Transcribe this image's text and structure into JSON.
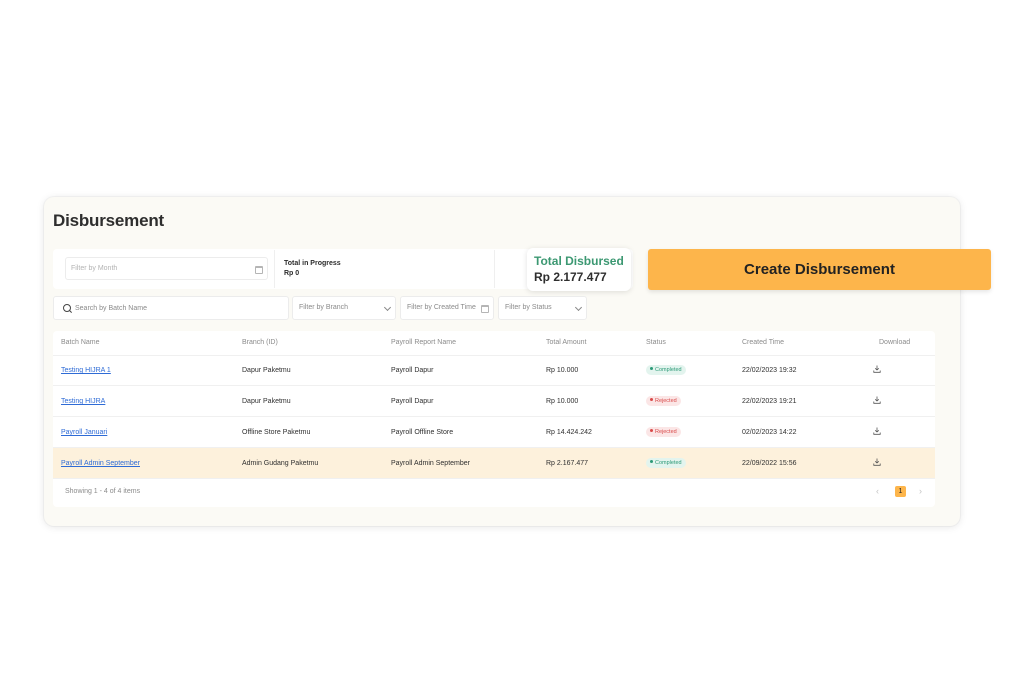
{
  "page": {
    "title": "Disbursement"
  },
  "summary": {
    "filter_month_placeholder": "Filter by Month",
    "in_progress_label": "Total in Progress",
    "in_progress_value": "Rp 0",
    "disbursed_label": "Total Disbursed",
    "disbursed_value": "Rp 2.177.477"
  },
  "actions": {
    "create_label": "Create Disbursement"
  },
  "filters": {
    "search_placeholder": "Search by Batch Name",
    "branch_placeholder": "Filter by Branch",
    "created_time_placeholder": "Filter by Created Time",
    "status_placeholder": "Filter by Status"
  },
  "table": {
    "columns": [
      "Batch Name",
      "Branch (ID)",
      "Payroll Report Name",
      "Total Amount",
      "Status",
      "Created Time",
      "Download"
    ],
    "rows": [
      {
        "batch": "Testing HIJRA 1",
        "branch": "Dapur Paketmu",
        "report": "Payroll Dapur",
        "amount": "Rp 10.000",
        "status": "Completed",
        "created": "22/02/2023 19:32"
      },
      {
        "batch": "Testing HIJRA",
        "branch": "Dapur Paketmu",
        "report": "Payroll Dapur",
        "amount": "Rp 10.000",
        "status": "Rejected",
        "created": "22/02/2023 19:21"
      },
      {
        "batch": "Payroll Januari",
        "branch": "Offline Store Paketmu",
        "report": "Payroll Offline Store",
        "amount": "Rp 14.424.242",
        "status": "Rejected",
        "created": "02/02/2023 14:22"
      },
      {
        "batch": "Payroll Admin September",
        "branch": "Admin Gudang Paketmu",
        "report": "Payroll Admin September",
        "amount": "Rp 2.167.477",
        "status": "Completed",
        "created": "22/09/2022 15:56"
      }
    ],
    "footer_text": "Showing 1 - 4 of 4 items",
    "pagination": {
      "prev": "‹",
      "current": "1",
      "next": "›"
    }
  },
  "icons": {
    "calendar": "calendar-icon",
    "search": "search-icon",
    "chevron": "chevron-down-icon",
    "download": "download-icon"
  },
  "colors": {
    "accent": "#fdb54b",
    "success": "#3c9872",
    "danger": "#d94a4a",
    "link": "#2e6bd6",
    "highlight_row": "#fdf1dc"
  }
}
